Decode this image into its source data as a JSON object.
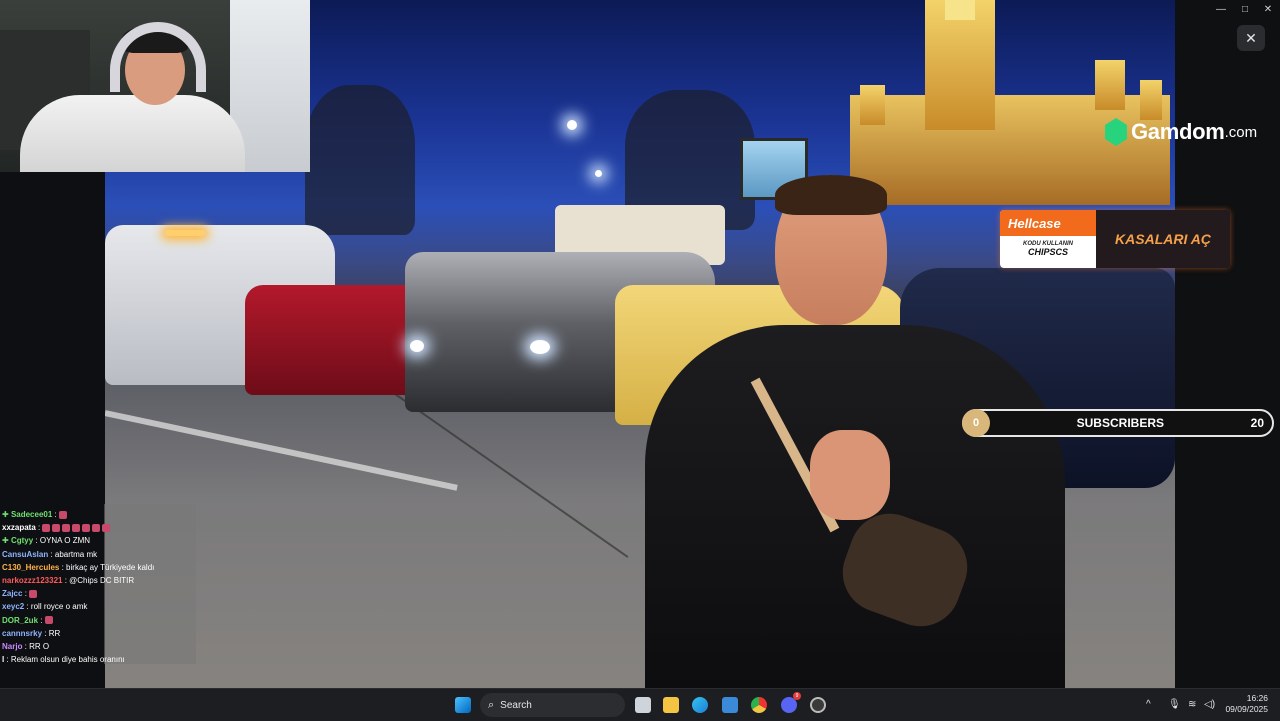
{
  "window": {
    "minimize_glyph": "—",
    "maximize_glyph": "□",
    "close_glyph": "✕",
    "overlay_close_glyph": "✕"
  },
  "overlay": {
    "gamdom": {
      "brand": "Gamdom",
      "tld": ".com",
      "color": "#28d37d"
    },
    "hellcase": {
      "brand": "Hellcase",
      "promo_line": "KODU KULLANIN",
      "code": "CHIPSCS",
      "cta": "KASALARI AÇ",
      "accent": "#f26a1b"
    },
    "subscribers": {
      "current": "0",
      "label": "SUBSCRIBERS",
      "goal": "20",
      "progress": 0
    }
  },
  "chat": {
    "messages": [
      {
        "user": "Sadecee01",
        "color": "#6fe06f",
        "text": "",
        "emotes": 1,
        "badge": true
      },
      {
        "user": "xxzapata",
        "color": "#ffffff",
        "text": "",
        "emotes": 7,
        "badge": false
      },
      {
        "user": "Cgtyy",
        "color": "#6fe06f",
        "text": "OYNA O ZMN",
        "emotes": 0,
        "badge": true
      },
      {
        "user": "CansuAslan",
        "color": "#8fb4ff",
        "text": "abartma mk",
        "emotes": 0,
        "badge": false
      },
      {
        "user": "C130_Hercules",
        "color": "#ffb347",
        "text": "birkaç ay Türkiyede kaldı",
        "emotes": 0,
        "badge": false
      },
      {
        "user": "narkozzz123321",
        "color": "#ff5b5b",
        "text": "@Chips DC BITIR",
        "emotes": 0,
        "badge": false
      },
      {
        "user": "Zajcc",
        "color": "#8fb4ff",
        "text": "",
        "emotes": 1,
        "badge": false
      },
      {
        "user": "xeyc2",
        "color": "#8fb4ff",
        "text": "roll royce o amk",
        "emotes": 0,
        "badge": false
      },
      {
        "user": "DOR_2uk",
        "color": "#6fe06f",
        "text": "",
        "emotes": 1,
        "badge": false
      },
      {
        "user": "cannnsrky",
        "color": "#8fb4ff",
        "text": "RR",
        "emotes": 0,
        "badge": false
      },
      {
        "user": "Narjo",
        "color": "#c98bff",
        "text": "RR O",
        "emotes": 0,
        "badge": false
      },
      {
        "user": "l",
        "color": "#ffffff",
        "text": "Reklam olsun diye bahis oranını",
        "emotes": 0,
        "badge": false
      }
    ]
  },
  "taskbar": {
    "search_label": "Search",
    "discord_badge": "9",
    "tray_chevron": "^",
    "time": "16:26",
    "date": "09/09/2025"
  }
}
